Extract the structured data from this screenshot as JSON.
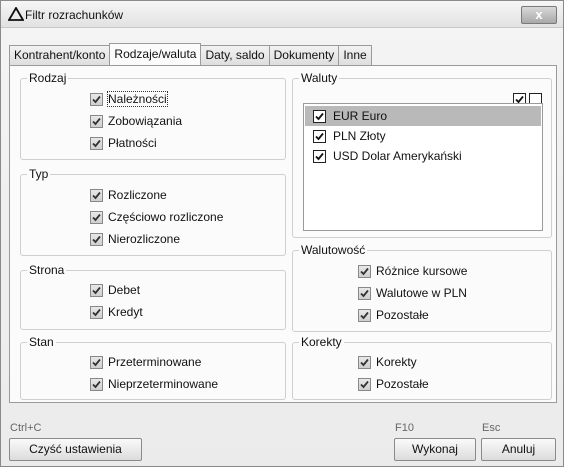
{
  "window": {
    "title": "Filtr rozrachunków",
    "close_label": "x"
  },
  "tabs": [
    {
      "label": "Kontrahent/konto",
      "active": false
    },
    {
      "label": "Rodzaje/waluta",
      "active": true
    },
    {
      "label": "Daty, saldo",
      "active": false
    },
    {
      "label": "Dokumenty",
      "active": false
    },
    {
      "label": "Inne",
      "active": false
    }
  ],
  "rodzaj": {
    "title": "Rodzaj",
    "items": [
      {
        "label": "Należności",
        "checked": true
      },
      {
        "label": "Zobowiązania",
        "checked": true
      },
      {
        "label": "Płatności",
        "checked": true
      }
    ]
  },
  "typ": {
    "title": "Typ",
    "items": [
      {
        "label": "Rozliczone",
        "checked": true
      },
      {
        "label": "Częściowo rozliczone",
        "checked": true
      },
      {
        "label": "Nierozliczone",
        "checked": true
      }
    ]
  },
  "strona": {
    "title": "Strona",
    "items": [
      {
        "label": "Debet",
        "checked": true
      },
      {
        "label": "Kredyt",
        "checked": true
      }
    ]
  },
  "stan": {
    "title": "Stan",
    "items": [
      {
        "label": "Przeterminowane",
        "checked": true
      },
      {
        "label": "Nieprzeterminowane",
        "checked": true
      }
    ]
  },
  "waluty": {
    "title": "Waluty",
    "select_all_checked": true,
    "select_none_checked": false,
    "items": [
      {
        "label": "EUR Euro",
        "checked": true,
        "selected": true
      },
      {
        "label": "PLN Złoty",
        "checked": true,
        "selected": false
      },
      {
        "label": "USD Dolar Amerykański",
        "checked": true,
        "selected": false
      }
    ]
  },
  "walutowosc": {
    "title": "Walutowość",
    "items": [
      {
        "label": "Różnice kursowe",
        "checked": true
      },
      {
        "label": "Walutowe w PLN",
        "checked": true
      },
      {
        "label": "Pozostałe",
        "checked": true
      }
    ]
  },
  "korekty": {
    "title": "Korekty",
    "items": [
      {
        "label": "Korekty",
        "checked": true
      },
      {
        "label": "Pozostałe",
        "checked": true
      }
    ]
  },
  "footer": {
    "clear_hotkey": "Ctrl+C",
    "clear_label": "Czyść ustawienia",
    "ok_hotkey": "F10",
    "ok_label": "Wykonaj",
    "cancel_hotkey": "Esc",
    "cancel_label": "Anuluj"
  }
}
